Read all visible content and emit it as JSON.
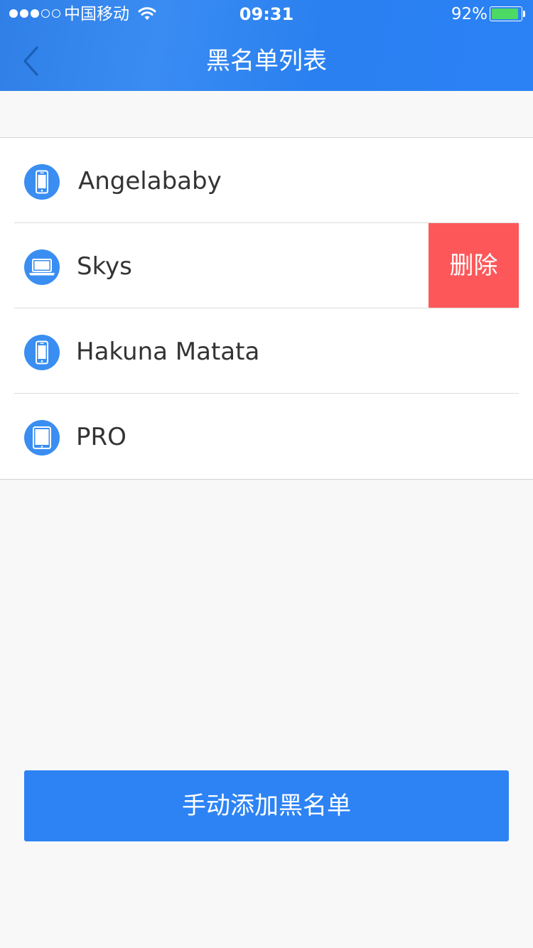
{
  "status_bar": {
    "carrier": "中国移动",
    "time": "09:31",
    "battery_percent": "92%",
    "battery_level": 0.92,
    "signal_bars_filled": 3,
    "signal_bars_total": 5
  },
  "nav": {
    "title": "黑名单列表",
    "back_icon": "chevron-left-icon"
  },
  "list": {
    "items": [
      {
        "label": "Angelababy",
        "icon": "phone-icon"
      },
      {
        "label": "Skys",
        "icon": "laptop-icon",
        "swiped": true,
        "action_label": "删除"
      },
      {
        "label": "Hakuna Matata",
        "icon": "phone-icon"
      },
      {
        "label": "PRO",
        "icon": "tablet-icon"
      }
    ]
  },
  "add_button": {
    "label": "手动添加黑名单"
  },
  "colors": {
    "primary": "#2d83f4",
    "delete": "#fe5759",
    "icon_bg": "#3a8ef2",
    "battery": "#4cd964"
  }
}
